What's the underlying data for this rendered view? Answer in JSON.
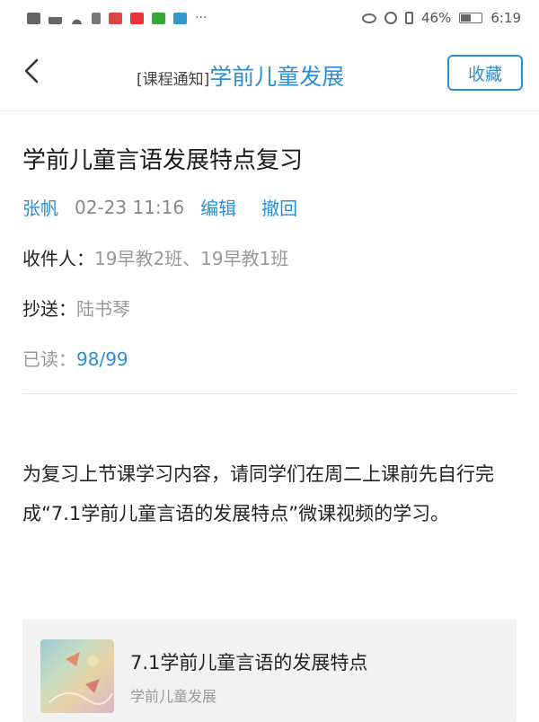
{
  "status_bar": {
    "battery": "46%",
    "time": "6:19"
  },
  "navbar": {
    "title_prefix": "[课程通知]",
    "title_course": "学前儿童发展",
    "favorite_label": "收藏"
  },
  "message": {
    "title": "学前儿童言语发展特点复习",
    "sender": "张帆",
    "time": "02-23 11:16",
    "edit_label": "编辑",
    "recall_label": "撤回",
    "recipients_label": "收件人：",
    "recipients_value": "19早教2班、19早教1班",
    "cc_label": "抄送：",
    "cc_value": "陆书琴",
    "read_label": "已读：",
    "read_value": "98/99",
    "body": "为复习上节课学习内容，请同学们在周二上课前先自行完成“7.1学前儿童言语的发展特点”微课视频的学习。"
  },
  "attachment": {
    "title": "7.1学前儿童言语的发展特点",
    "subtitle": "学前儿童发展"
  }
}
